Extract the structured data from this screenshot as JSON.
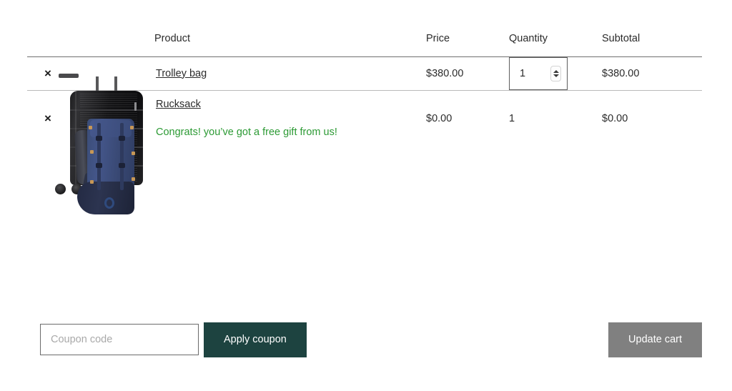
{
  "table": {
    "headers": {
      "remove": "",
      "thumb": "",
      "product": "Product",
      "price": "Price",
      "quantity": "Quantity",
      "subtotal": "Subtotal"
    },
    "rows": [
      {
        "remove_label": "×",
        "image_alt": "black-trolley-suitcase",
        "name": "Trolley bag",
        "note": "",
        "price": "$380.00",
        "quantity_value": "1",
        "quantity_editable": true,
        "subtotal": "$380.00"
      },
      {
        "remove_label": "×",
        "image_alt": "blue-rucksack-backpack",
        "name": "Rucksack",
        "note": "Congrats! you’ve got a free gift from us!",
        "price": "$0.00",
        "quantity_value": "1",
        "quantity_editable": false,
        "subtotal": "$0.00"
      }
    ]
  },
  "actions": {
    "coupon_placeholder": "Coupon code",
    "coupon_value": "",
    "apply_label": "Apply coupon",
    "update_label": "Update cart"
  },
  "colors": {
    "accent_teal": "#1d4340",
    "disabled_gray": "#808080",
    "free_gift_green": "#2c9a34",
    "text": "#2b2b2b",
    "header_rule": "#6f6f6f",
    "row_rule": "#b9b9b9",
    "placeholder": "#a9a9a9"
  }
}
